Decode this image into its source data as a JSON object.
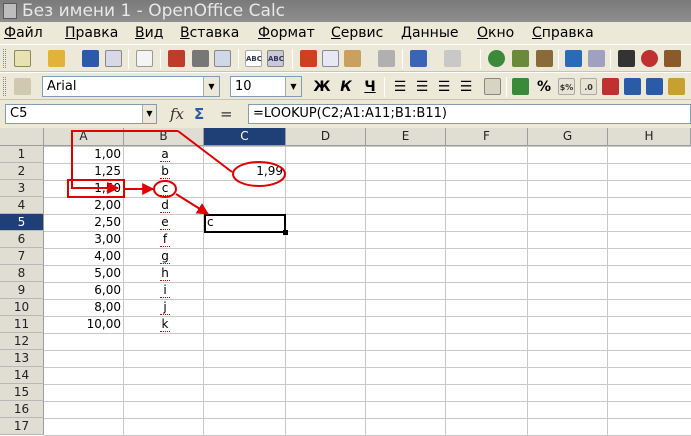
{
  "window": {
    "title": "Без имени 1 - OpenOffice Calc"
  },
  "menu": [
    "Файл",
    "Правка",
    "Вид",
    "Вставка",
    "Формат",
    "Сервис",
    "Данные",
    "Окно",
    "Справка"
  ],
  "format_toolbar": {
    "font_name": "Arial",
    "font_size": "10",
    "bold_label": "Ж",
    "italic_label": "К",
    "underline_label": "Ч",
    "percent_label": "%"
  },
  "formula_bar": {
    "cell_ref": "C5",
    "fx_label": "fx",
    "sum_label": "Σ",
    "equals_label": "=",
    "formula": "=LOOKUP(C2;A1:A11;B1:B11)"
  },
  "sheet": {
    "columns": [
      "A",
      "B",
      "C",
      "D",
      "E",
      "F",
      "G",
      "H"
    ],
    "rows": [
      "1",
      "2",
      "3",
      "4",
      "5",
      "6",
      "7",
      "8",
      "9",
      "10",
      "11",
      "12",
      "13",
      "14",
      "15",
      "16",
      "17"
    ],
    "col_a": [
      "1,00",
      "1,25",
      "1,50",
      "2,00",
      "2,50",
      "3,00",
      "4,00",
      "5,00",
      "6,00",
      "8,00",
      "10,00"
    ],
    "col_b": [
      "a",
      "b",
      "c",
      "d",
      "e",
      "f",
      "g",
      "h",
      "i",
      "j",
      "k"
    ],
    "c2": "1,99",
    "c5": "c"
  },
  "colors": {
    "active_header": "#1f3f77",
    "annotation": "#e00000"
  }
}
